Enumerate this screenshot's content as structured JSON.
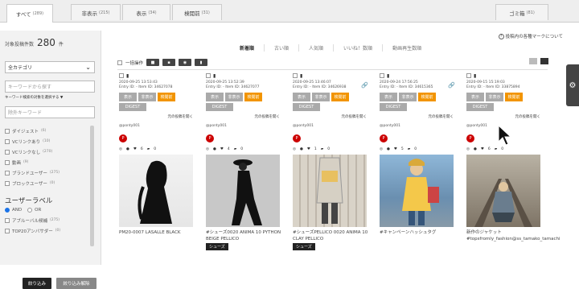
{
  "tabs": [
    {
      "label": "すべて",
      "count": "(289)"
    },
    {
      "label": "非表示",
      "count": "(215)"
    },
    {
      "label": "表示",
      "count": "(34)"
    },
    {
      "label": "検閲前",
      "count": "(31)"
    }
  ],
  "trash_tab": {
    "label": "ゴミ箱",
    "count": "(81)"
  },
  "sidebar": {
    "count_label": "対象投稿件数",
    "count_value": "280",
    "count_unit": "件",
    "category_select": "全カテゴリ",
    "keyword_placeholder": "キーワードから探す",
    "keyword_hint": "キーワード検索の対象を選択する ▼",
    "exclude_placeholder": "除外キーワード",
    "categories": [
      {
        "label": "ダイジェスト",
        "count": "(6)"
      },
      {
        "label": "VCリンクあり",
        "count": "(10)"
      },
      {
        "label": "VCリンクなし",
        "count": "(270)"
      },
      {
        "label": "動画",
        "count": "(9)"
      },
      {
        "label": "ブランドユーザー",
        "count": "(275)"
      },
      {
        "label": "ブロックユーザー",
        "count": "(0)"
      }
    ],
    "user_label_title": "ユーザーラベル",
    "and_label": "AND",
    "or_label": "OR",
    "user_labels": [
      {
        "label": "アブルーバル候補",
        "count": "(275)"
      },
      {
        "label": "TOP20アンバサダー",
        "count": "(0)"
      }
    ],
    "filter_button": "絞り込み",
    "clear_button": "絞り込み解除"
  },
  "main": {
    "help_text": "投稿内の各種マークについて",
    "sort_options": [
      "新着順",
      "古い順",
      "人気順",
      "いいね！数順",
      "動画再生数順"
    ],
    "bulk_label": "一括操作"
  },
  "card_buttons": {
    "show": "表示",
    "hide": "非表示",
    "moderate": "検閲前",
    "digest": "DIGEST",
    "open": "元の投稿を開く"
  },
  "cards": [
    {
      "date": "2020-09-25 13:53:43",
      "entry": "Entry ID: - Item ID: 34627078",
      "user": "@ponty001",
      "likes": "6",
      "comments": "0",
      "caption": "PM20-0007 LASALLE BLACK",
      "tag": "",
      "active": "moderate",
      "link": false
    },
    {
      "date": "2020-09-25 13:52:39",
      "entry": "Entry ID: - Item ID: 34627077",
      "user": "@ponty001",
      "likes": "4",
      "comments": "0",
      "caption": "#シューズ0020 ANIMA 10 PYTHON BEIGE PELLICO",
      "tag": "シューズ",
      "active": "moderate",
      "link": false
    },
    {
      "date": "2020-09-25 13:46:07",
      "entry": "Entry ID: - Item ID: 34626938",
      "user": "@ponty001",
      "likes": "1",
      "comments": "0",
      "caption": "#シューズPELLICO 0020 ANIMA 10 CLAY PELLICO",
      "tag": "シューズ",
      "active": "moderate",
      "link": true
    },
    {
      "date": "2020-09-24 17:56:25",
      "entry": "Entry ID: - Item ID: 34615365",
      "user": "@ponty001",
      "likes": "5",
      "comments": "0",
      "caption": "#キャンペーンハッシュタグ",
      "tag": "",
      "active": "moderate",
      "link": true
    },
    {
      "date": "2020-09-15 15:19:03",
      "entry": "Entry ID: - Item ID: 33875894",
      "user": "@ponty001",
      "likes": "6",
      "comments": "0",
      "caption": "新作のジャケット#topsfromly_fashion@ss_tamako_tamachi",
      "tag": "",
      "active": "moderate",
      "link": false
    }
  ]
}
